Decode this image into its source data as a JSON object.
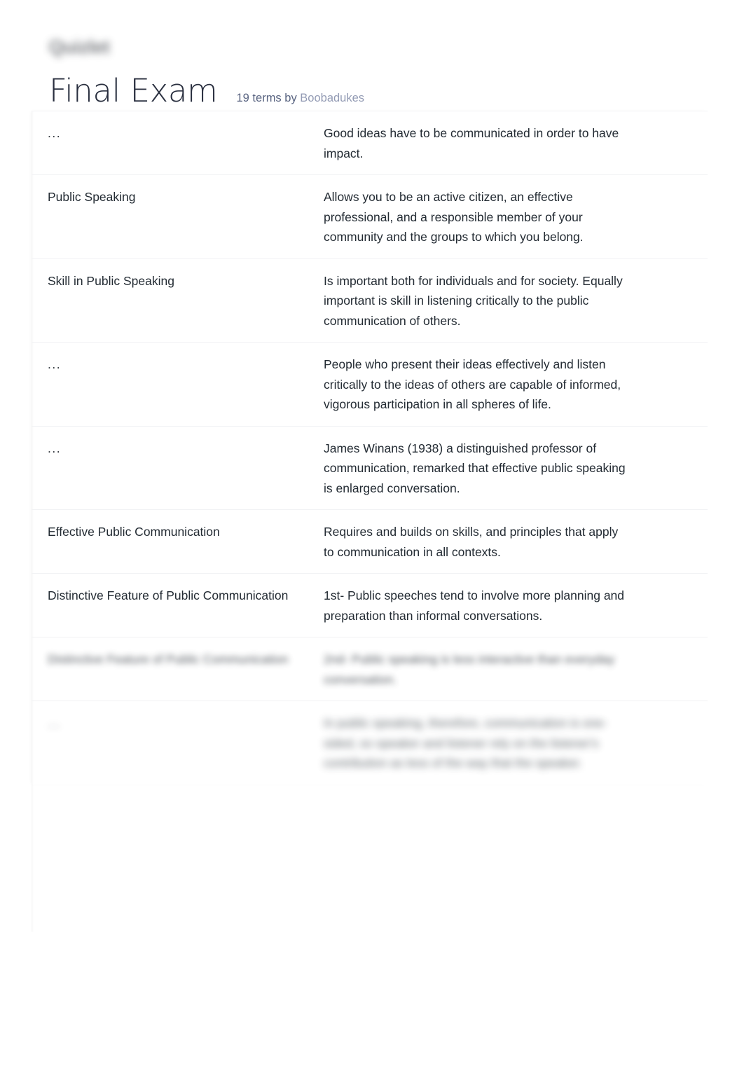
{
  "header": {
    "logo_text": "Quizlet",
    "logo_name": "quizlet-logo",
    "title": "Final Exam",
    "terms_count_label": "19 terms by",
    "author": "Boobadukes"
  },
  "colors": {
    "text": "#232b33",
    "title": "#282e3e",
    "meta": "#586380",
    "author": "#939bb4",
    "divider": "#f1f2f4",
    "background": "#ffffff"
  },
  "study_set": {
    "rows": [
      {
        "term": "...",
        "definition": "Good ideas have to be communicated in order to have impact.",
        "blurred": false
      },
      {
        "term": "Public Speaking",
        "definition": "Allows you to be an active citizen, an effective professional, and a responsible member of your community and the groups to which you belong.",
        "blurred": false
      },
      {
        "term": "Skill in Public Speaking",
        "definition": "Is important both for individuals and for society. Equally important is skill in listening critically to the public communication of others.",
        "blurred": false
      },
      {
        "term": "...",
        "definition": "People who present their ideas effectively and listen critically to the ideas of others are capable of informed, vigorous participation in all spheres of life.",
        "blurred": false
      },
      {
        "term": "...",
        "definition": "James Winans (1938) a distinguished professor of communication, remarked that effective public speaking is enlarged conversation.",
        "blurred": false
      },
      {
        "term": "Effective Public Communication",
        "definition": "Requires and builds on skills, and principles that apply to communication in all contexts.",
        "blurred": false
      },
      {
        "term": "Distinctive Feature of Public Communication",
        "definition": "1st- Public speeches tend to involve more planning and preparation than informal conversations.",
        "blurred": false
      },
      {
        "term": "Distinctive Feature of Public Communication",
        "definition": "2nd- Public speaking is less interactive than everyday conversation.",
        "blurred": true
      },
      {
        "term": "...",
        "definition": "In public speaking, therefore, communication is one-sided, so speaker and listener rely on the listener's contribution as less of the way that the speaker.",
        "blurred": true
      }
    ]
  }
}
